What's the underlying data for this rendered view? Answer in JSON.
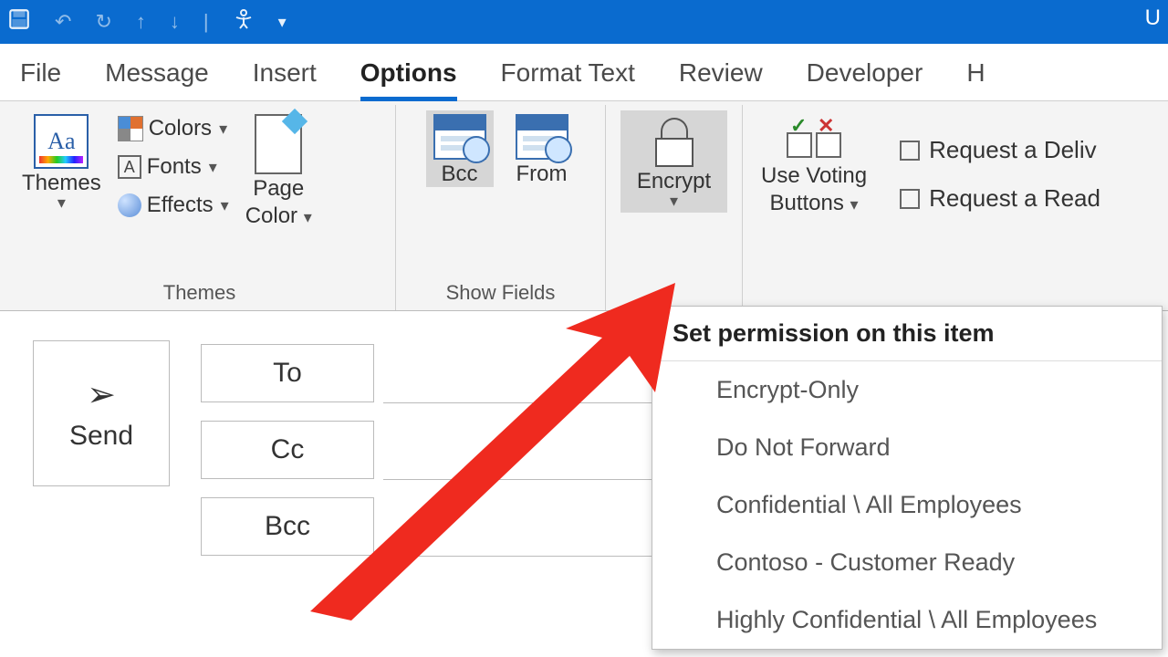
{
  "titlebar": {
    "right_text": "U"
  },
  "tabs": {
    "file": "File",
    "message": "Message",
    "insert": "Insert",
    "options": "Options",
    "format_text": "Format Text",
    "review": "Review",
    "developer": "Developer",
    "help_partial": "H"
  },
  "ribbon": {
    "themes": {
      "group_label": "Themes",
      "themes_btn": "Themes",
      "colors": "Colors",
      "fonts": "Fonts",
      "effects": "Effects",
      "page_color": "Page",
      "page_color2": "Color"
    },
    "show_fields": {
      "group_label": "Show Fields",
      "bcc": "Bcc",
      "from": "From"
    },
    "encrypt": {
      "label": "Encrypt"
    },
    "voting": {
      "line1": "Use Voting",
      "line2": "Buttons"
    },
    "tracking": {
      "delivery": "Request a Deliv",
      "read": "Request a Read"
    }
  },
  "compose": {
    "send": "Send",
    "to": "To",
    "cc": "Cc",
    "bcc": "Bcc"
  },
  "dropdown": {
    "header": "Set permission on this item",
    "items": [
      "Encrypt-Only",
      "Do Not Forward",
      "Confidential \\ All Employees",
      "Contoso - Customer Ready",
      "Highly Confidential \\ All Employees"
    ]
  }
}
